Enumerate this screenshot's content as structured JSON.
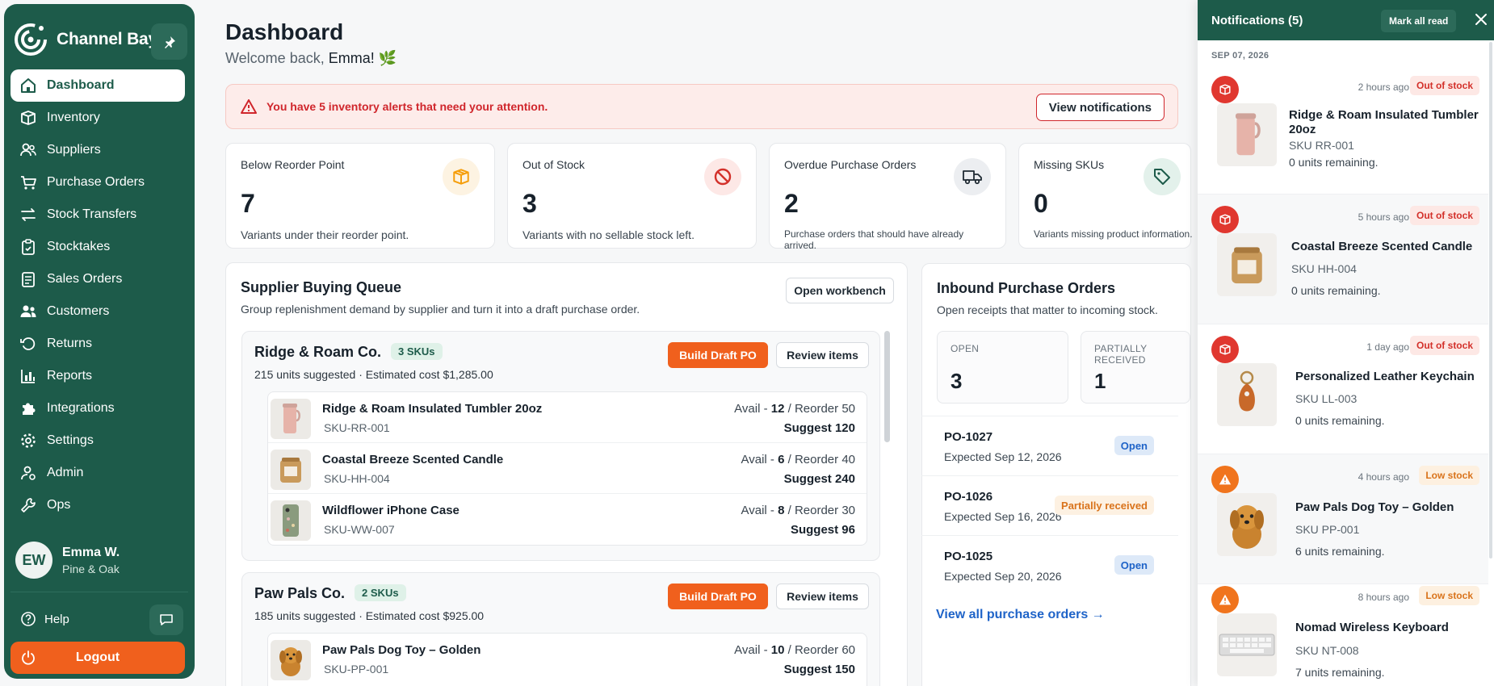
{
  "sidebar": {
    "brand": "Channel Bay",
    "items": [
      {
        "label": "Dashboard",
        "icon": "home-icon"
      },
      {
        "label": "Inventory",
        "icon": "box-icon"
      },
      {
        "label": "Suppliers",
        "icon": "users-icon"
      },
      {
        "label": "Purchase Orders",
        "icon": "cart-icon"
      },
      {
        "label": "Stock Transfers",
        "icon": "transfer-icon"
      },
      {
        "label": "Stocktakes",
        "icon": "clipboard-icon"
      },
      {
        "label": "Sales Orders",
        "icon": "document-icon"
      },
      {
        "label": "Customers",
        "icon": "people-icon"
      },
      {
        "label": "Returns",
        "icon": "return-icon"
      },
      {
        "label": "Reports",
        "icon": "chart-icon"
      },
      {
        "label": "Integrations",
        "icon": "puzzle-icon"
      },
      {
        "label": "Settings",
        "icon": "gear-icon"
      },
      {
        "label": "Admin",
        "icon": "admin-icon"
      },
      {
        "label": "Ops",
        "icon": "wrench-icon"
      }
    ],
    "user": {
      "initials": "EW",
      "name": "Emma W.",
      "org": "Pine & Oak"
    },
    "help": "Help",
    "logout": "Logout"
  },
  "header": {
    "title": "Dashboard",
    "welcome_prefix": "Welcome back,",
    "welcome_name": "Emma!",
    "welcome_emoji": "🌿"
  },
  "alert": {
    "text": "You have 5 inventory alerts that need your attention.",
    "button": "View notifications"
  },
  "kpis": [
    {
      "label": "Below Reorder Point",
      "value": "7",
      "desc": "Variants under their reorder point.",
      "icon": "box-icon",
      "color": "#f59e0b"
    },
    {
      "label": "Out of Stock",
      "value": "3",
      "desc": "Variants with no sellable stock left.",
      "icon": "ban-icon",
      "color": "#d3302a"
    },
    {
      "label": "Overdue Purchase Orders",
      "value": "2",
      "desc": "Purchase orders that should have already arrived.",
      "icon": "truck-icon",
      "color": "#1f2a33"
    },
    {
      "label": "Missing SKUs",
      "value": "0",
      "desc": "Variants missing product information.",
      "icon": "tag-icon",
      "color": "#1d5b4a"
    }
  ],
  "queue": {
    "title": "Supplier Buying Queue",
    "subtitle": "Group replenishment demand by supplier and turn it into a draft purchase order.",
    "open_button": "Open workbench",
    "build_label": "Build Draft PO",
    "review_label": "Review items",
    "groups": [
      {
        "name": "Ridge & Roam Co.",
        "pill": "3 SKUs",
        "meta": "215 units suggested · Estimated cost $1,285.00",
        "items": [
          {
            "name": "Ridge & Roam Insulated Tumbler 20oz",
            "sku": "SKU-RR-001",
            "avail": "12",
            "reorder": "50",
            "suggest": "Suggest 120"
          },
          {
            "name": "Coastal Breeze Scented Candle",
            "sku": "SKU-HH-004",
            "avail": "6",
            "reorder": "40",
            "suggest": "Suggest 240"
          },
          {
            "name": "Wildflower iPhone Case",
            "sku": "SKU-WW-007",
            "avail": "8",
            "reorder": "30",
            "suggest": "Suggest 96"
          }
        ]
      },
      {
        "name": "Paw Pals Co.",
        "pill": "2 SKUs",
        "meta": "185 units suggested · Estimated cost $925.00",
        "items": [
          {
            "name": "Paw Pals Dog Toy – Golden",
            "sku": "SKU-PP-001",
            "avail": "10",
            "reorder": "60",
            "suggest": "Suggest 150"
          }
        ]
      }
    ],
    "avail_label": "Avail -",
    "reorder_label": "/ Reorder"
  },
  "inbound": {
    "title": "Inbound Purchase Orders",
    "subtitle": "Open receipts that matter to incoming stock.",
    "stats": [
      {
        "label": "OPEN",
        "value": "3"
      },
      {
        "label": "PARTIALLY RECEIVED",
        "value": "1"
      }
    ],
    "orders": [
      {
        "id": "PO-1027",
        "expected": "Expected Sep 12, 2026",
        "status": "Open"
      },
      {
        "id": "PO-1026",
        "expected": "Expected Sep 16, 2026",
        "status": "Partially received"
      },
      {
        "id": "PO-1025",
        "expected": "Expected Sep 20, 2026",
        "status": "Open"
      }
    ],
    "link": "View all purchase orders →"
  },
  "notifications": {
    "title": "Notifications (5)",
    "mark_all": "Mark all read",
    "date": "SEP 07, 2026",
    "items": [
      {
        "time": "2 hours ago",
        "badge": "Out of stock",
        "name": "Ridge & Roam Insulated Tumbler 20oz",
        "sku": "SKU  RR-001",
        "units": "0 units remaining."
      },
      {
        "time": "5 hours ago",
        "badge": "Out of stock",
        "name": "Coastal Breeze Scented Candle",
        "sku": "SKU  HH-004",
        "units": "0 units remaining."
      },
      {
        "time": "1 day ago",
        "badge": "Out of stock",
        "name": "Personalized Leather Keychain",
        "sku": "SKU  LL-003",
        "units": "0 units remaining."
      },
      {
        "time": "4 hours ago",
        "badge": "Low stock",
        "name": "Paw Pals Dog Toy – Golden",
        "sku": "SKU  PP-001",
        "units": "6 units remaining."
      },
      {
        "time": "8 hours ago",
        "badge": "Low stock",
        "name": "Nomad Wireless Keyboard",
        "sku": "SKU  NT-008",
        "units": "7 units remaining."
      }
    ]
  },
  "colors": {
    "brand": "#1d5b4a",
    "accent": "#f0601d",
    "danger": "#d0262c",
    "link": "#1e63c8"
  }
}
